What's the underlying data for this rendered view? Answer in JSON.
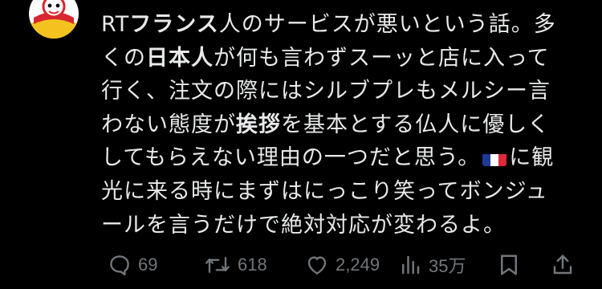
{
  "tweet": {
    "line1": {
      "a": "RT",
      "b": "フランス",
      "c": "人のサービスが悪いという話。多"
    },
    "line2": {
      "a": "くの",
      "b": "日本人",
      "c": "が何も言わずスーッと店に入って"
    },
    "line3": "行く、注文の際にはシルブプレもメルシー言",
    "line4": {
      "a": "わない態度が",
      "b": "挨拶",
      "c": "を基本とする仏人に優しく"
    },
    "line5": {
      "a": "してもらえない理由の一つだと思う。",
      "flag": "flag-france-icon",
      "c": "に観"
    },
    "line6": "光に来る時にまずはにっこり笑ってボンジュ",
    "line7": "ールを言うだけで絶対対応が変わるよ。"
  },
  "actions": {
    "replies": "69",
    "reposts": "618",
    "likes": "2,249",
    "views": "35万"
  },
  "icons": {
    "reply": "speech-bubble-icon",
    "repost": "repost-arrows-icon",
    "like": "heart-icon",
    "views": "bar-chart-icon",
    "bookmark": "bookmark-icon",
    "share": "share-upload-icon"
  },
  "colors": {
    "background": "#000000",
    "text": "#e7e9ea",
    "secondary": "#71767b",
    "flag_blue": "#1f3a93",
    "flag_white": "#ffffff",
    "flag_red": "#e0283b"
  }
}
